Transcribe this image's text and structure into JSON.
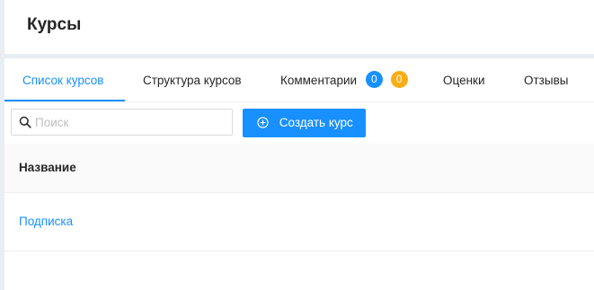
{
  "header": {
    "title": "Курсы"
  },
  "tabs": [
    {
      "label": "Список курсов",
      "active": true
    },
    {
      "label": "Структура курсов",
      "active": false
    },
    {
      "label": "Комментарии",
      "active": false,
      "badges": [
        "0",
        "0"
      ]
    },
    {
      "label": "Оценки",
      "active": false
    },
    {
      "label": "Отзывы",
      "active": false
    }
  ],
  "toolbar": {
    "search_placeholder": "Поиск",
    "search_value": "",
    "create_label": "Создать курс"
  },
  "table": {
    "columns": [
      "Название"
    ],
    "rows": [
      {
        "name": "Подписка"
      }
    ]
  },
  "colors": {
    "accent": "#1890ff",
    "badge_orange": "#faad14",
    "background": "#e9eef3"
  }
}
